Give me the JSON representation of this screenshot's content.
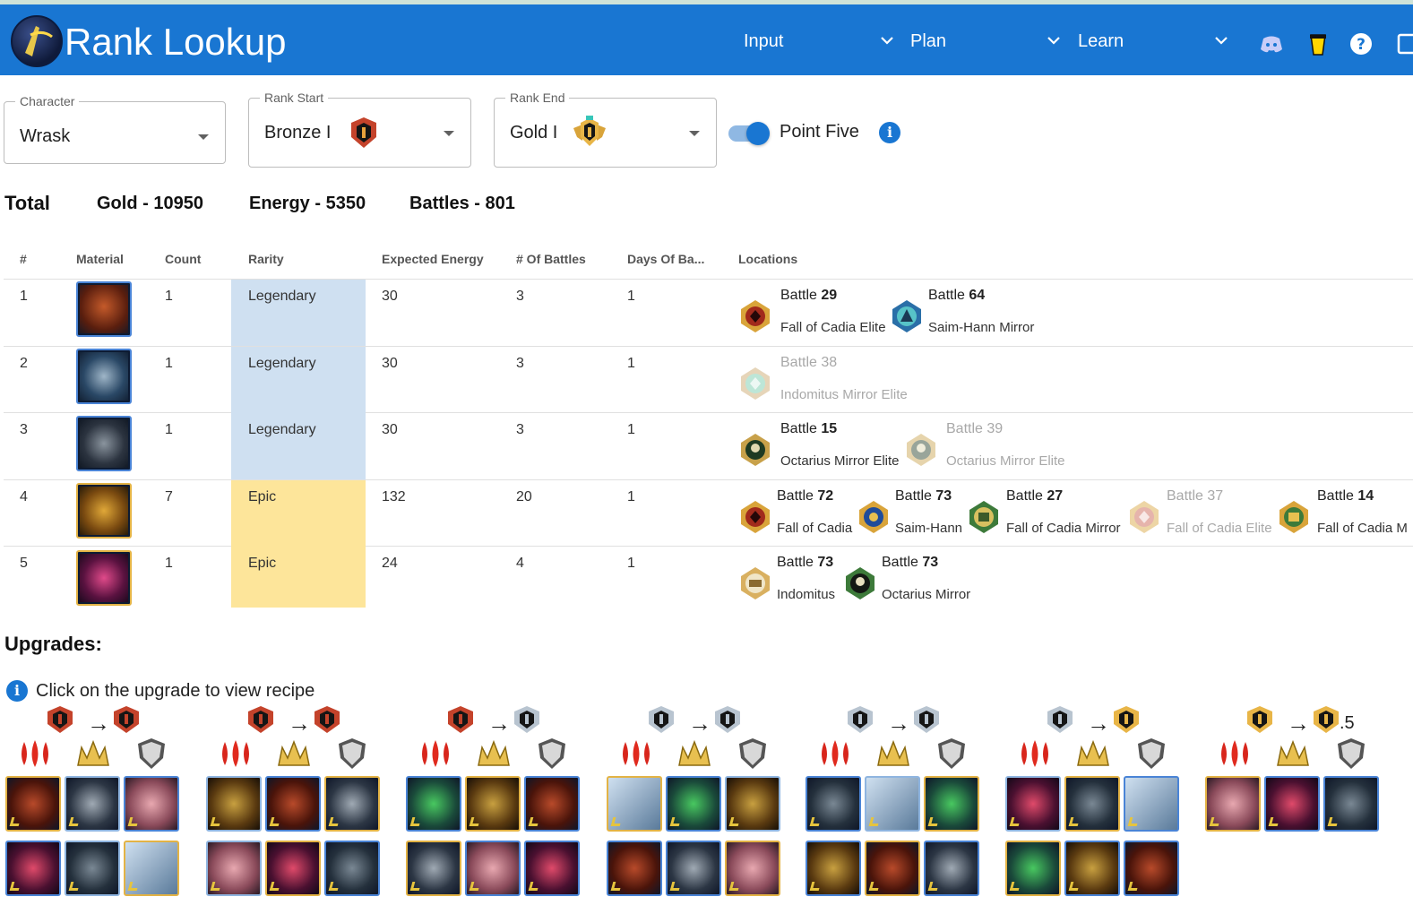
{
  "header": {
    "title": "Rank Lookup",
    "nav": [
      {
        "label": "Input"
      },
      {
        "label": "Plan"
      },
      {
        "label": "Learn"
      }
    ],
    "icons": [
      "discord-icon",
      "coffee-cup-icon",
      "help-icon",
      "window-icon"
    ]
  },
  "filters": {
    "character": {
      "label": "Character",
      "value": "Wrask"
    },
    "rank_start": {
      "label": "Rank Start",
      "value": "Bronze I"
    },
    "rank_end": {
      "label": "Rank End",
      "value": "Gold I"
    },
    "point_five": {
      "label": "Point Five",
      "on": true
    }
  },
  "totals": {
    "label": "Total",
    "gold": "Gold - 10950",
    "energy": "Energy - 5350",
    "battles": "Battles - 801"
  },
  "table": {
    "headers": [
      "#",
      "Material",
      "Count",
      "Rarity",
      "Expected Energy",
      "# Of Battles",
      "Days Of Ba...",
      "Locations"
    ],
    "rows": [
      {
        "num": "1",
        "count": "1",
        "rarity": "Legendary",
        "energy": "30",
        "battles": "3",
        "days": "1",
        "locations": [
          {
            "battle": "Battle ",
            "n": "29",
            "name": "Fall of Cadia Elite",
            "dim": false
          },
          {
            "battle": "Battle ",
            "n": "64",
            "name": "Saim-Hann Mirror",
            "dim": false
          }
        ]
      },
      {
        "num": "2",
        "count": "1",
        "rarity": "Legendary",
        "energy": "30",
        "battles": "3",
        "days": "1",
        "locations": [
          {
            "battle": "Battle ",
            "n": "38",
            "name": "Indomitus Mirror Elite",
            "dim": true
          }
        ]
      },
      {
        "num": "3",
        "count": "1",
        "rarity": "Legendary",
        "energy": "30",
        "battles": "3",
        "days": "1",
        "locations": [
          {
            "battle": "Battle ",
            "n": "15",
            "name": "Octarius Mirror Elite",
            "dim": false
          },
          {
            "battle": "Battle ",
            "n": "39",
            "name": "Octarius Mirror Elite",
            "dim": true
          }
        ]
      },
      {
        "num": "4",
        "count": "7",
        "rarity": "Epic",
        "energy": "132",
        "battles": "20",
        "days": "1",
        "locations": [
          {
            "battle": "Battle ",
            "n": "72",
            "name": "Fall of Cadia",
            "dim": false
          },
          {
            "battle": "Battle ",
            "n": "73",
            "name": "Saim-Hann",
            "dim": false
          },
          {
            "battle": "Battle ",
            "n": "27",
            "name": "Fall of Cadia Mirror",
            "dim": false
          },
          {
            "battle": "Battle ",
            "n": "37",
            "name": "Fall of Cadia Elite",
            "dim": true
          },
          {
            "battle": "Battle ",
            "n": "14",
            "name": "Fall of Cadia M",
            "dim": false
          }
        ]
      },
      {
        "num": "5",
        "count": "1",
        "rarity": "Epic",
        "energy": "24",
        "battles": "4",
        "days": "1",
        "locations": [
          {
            "battle": "Battle ",
            "n": "73",
            "name": "Indomitus",
            "dim": false
          },
          {
            "battle": "Battle ",
            "n": "73",
            "name": "Octarius Mirror",
            "dim": false
          }
        ]
      }
    ]
  },
  "upgrades": {
    "title": "Upgrades:",
    "note": "Click on the upgrade to view recipe",
    "last_suffix": ".5"
  },
  "colors": {
    "appbar": "#1976d2",
    "legendary": "#cfe0f1",
    "epic": "#fde59a"
  }
}
